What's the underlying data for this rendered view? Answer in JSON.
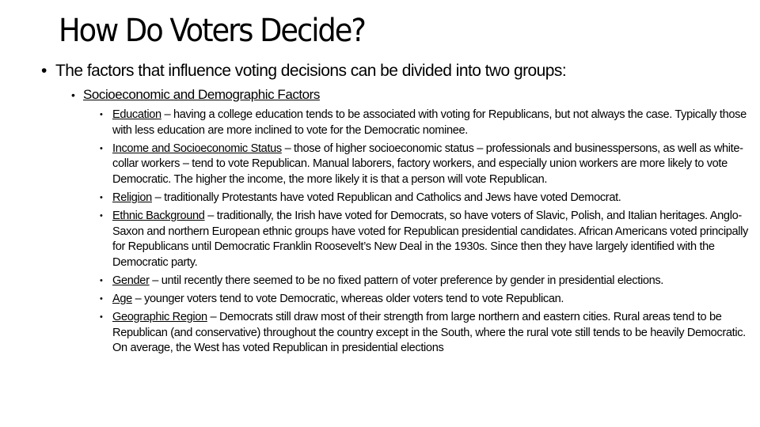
{
  "slide": {
    "title": "How Do Voters Decide?",
    "level1": {
      "bullet": "•",
      "text": "The factors that influence voting decisions can be divided into two groups:"
    },
    "level2": {
      "bullet": "•",
      "text": "Socioeconomic and Demographic Factors"
    },
    "factors": [
      {
        "term": "Education",
        "text": " – having a college education tends to be associated with voting for Republicans, but not always the case.  Typically those with less education are more inclined to vote for the Democratic nominee."
      },
      {
        "term": "Income and Socioeconomic Status",
        "text": " – those of higher socioeconomic status – professionals and businesspersons, as well as white-collar workers – tend to vote Republican.  Manual laborers, factory workers, and especially union workers are more likely to vote Democratic.  The higher the income, the more likely it is that a person will vote Republican."
      },
      {
        "term": "Religion",
        "text": " – traditionally Protestants have voted Republican and Catholics and Jews have voted Democrat."
      },
      {
        "term": "Ethnic Background",
        "text": " – traditionally, the Irish have voted for Democrats, so have voters of Slavic, Polish, and Italian heritages.  Anglo-Saxon and northern European ethnic groups have voted for Republican presidential candidates.  African Americans voted principally for Republicans until Democratic Franklin Roosevelt’s New Deal in the 1930s.  Since then they have largely identified with the Democratic party."
      },
      {
        "term": "Gender",
        "text": " – until recently there seemed to be no fixed pattern of voter preference by gender in presidential elections."
      },
      {
        "term": "Age",
        "text": " – younger voters tend to vote Democratic, whereas older voters tend to vote Republican."
      },
      {
        "term": "Geographic Region",
        "text": " – Democrats still draw most of their strength from large northern and eastern cities.  Rural areas tend to be Republican (and conservative) throughout the country except in the South, where the rural vote still tends to be heavily Democratic.  On average, the West has voted Republican in presidential elections"
      }
    ]
  }
}
